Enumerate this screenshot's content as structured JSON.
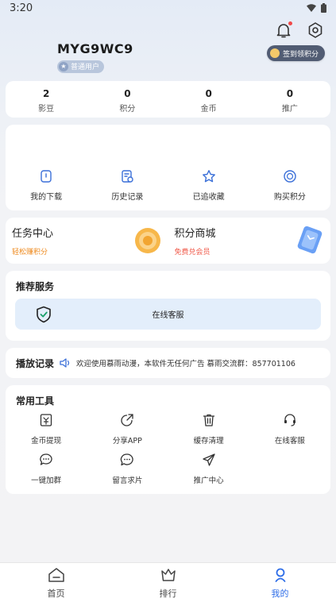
{
  "status": {
    "time": "3:20"
  },
  "profile": {
    "username": "MYG9WC9",
    "badge": "普通用户"
  },
  "signin": {
    "label": "签到领积分"
  },
  "stats": [
    {
      "value": "2",
      "label": "影豆"
    },
    {
      "value": "0",
      "label": "积分"
    },
    {
      "value": "0",
      "label": "金币"
    },
    {
      "value": "0",
      "label": "推广"
    }
  ],
  "quick": [
    {
      "label": "我的下载",
      "icon": "download-icon"
    },
    {
      "label": "历史记录",
      "icon": "history-icon"
    },
    {
      "label": "已追收藏",
      "icon": "star-icon"
    },
    {
      "label": "购买积分",
      "icon": "coin-icon"
    }
  ],
  "promo": {
    "task": {
      "title": "任务中心",
      "sub": "轻松赚积分"
    },
    "mall": {
      "title": "积分商城",
      "sub": "免费兑会员"
    }
  },
  "recommend": {
    "title": "推荐服务",
    "service_label": "在线客服"
  },
  "history": {
    "title": "播放记录",
    "notice": "欢迎使用慕雨动漫，本软件无任何广告 慕雨交流群：857701106"
  },
  "tools": {
    "title": "常用工具",
    "items": [
      {
        "label": "金币提现",
        "icon": "withdraw-icon"
      },
      {
        "label": "分享APP",
        "icon": "share-icon"
      },
      {
        "label": "缓存清理",
        "icon": "trash-icon"
      },
      {
        "label": "在线客服",
        "icon": "headset-icon"
      },
      {
        "label": "一键加群",
        "icon": "chat-group-icon"
      },
      {
        "label": "留言求片",
        "icon": "message-icon"
      },
      {
        "label": "推广中心",
        "icon": "send-icon"
      }
    ]
  },
  "tabs": [
    {
      "label": "首页",
      "icon": "home-icon"
    },
    {
      "label": "排行",
      "icon": "ranking-icon"
    },
    {
      "label": "我的",
      "icon": "user-icon"
    }
  ],
  "colors": {
    "accent": "#2f6ee8",
    "orange": "#ee8a1e",
    "red": "#f05a4a"
  }
}
